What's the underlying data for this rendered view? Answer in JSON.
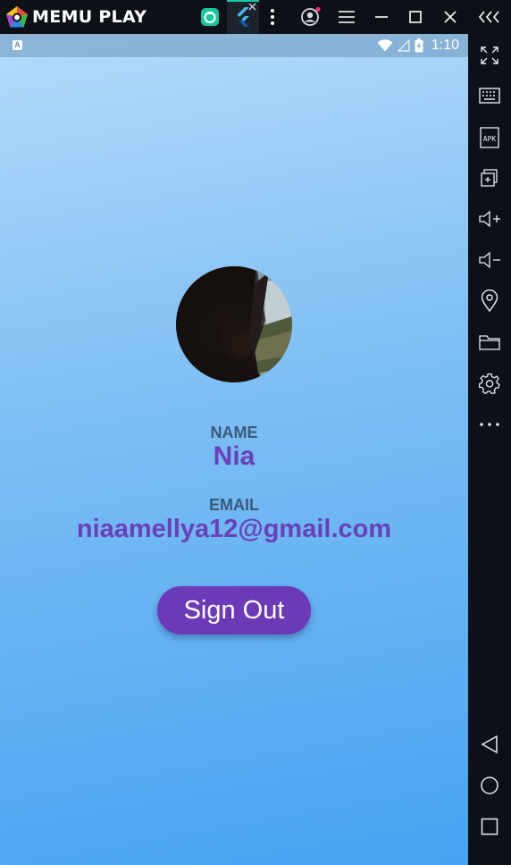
{
  "window": {
    "app_name": "MEMU PLAY",
    "brand_color": "#ffffff",
    "tabs": [
      {
        "name": "apps-tab",
        "icon": "android-app-icon"
      },
      {
        "name": "flutter-tab",
        "icon": "flutter-icon",
        "active": true
      }
    ],
    "controls": [
      "more-vertical-icon",
      "account-icon",
      "menu-icon",
      "minimize-icon",
      "maximize-icon",
      "close-icon",
      "collapse-icon"
    ]
  },
  "status_bar": {
    "time": "1:10",
    "icons": [
      "notification-a-icon",
      "wifi-icon",
      "signal-icon",
      "battery-icon"
    ]
  },
  "profile": {
    "name_label": "NAME",
    "name_value": "Nia",
    "email_label": "EMAIL",
    "email_value": "niaamellya12@gmail.com",
    "signout_label": "Sign Out",
    "accent_color": "#6a3fb8"
  },
  "sidebar": {
    "icons": [
      "fullscreen-icon",
      "keyboard-icon",
      "apk-icon",
      "multi-instance-icon",
      "volume-up-icon",
      "volume-down-icon",
      "location-icon",
      "folder-icon",
      "settings-icon",
      "more-icon"
    ],
    "apk_text": "APK",
    "nav_icons": [
      "back-icon",
      "home-icon",
      "recents-icon"
    ]
  }
}
